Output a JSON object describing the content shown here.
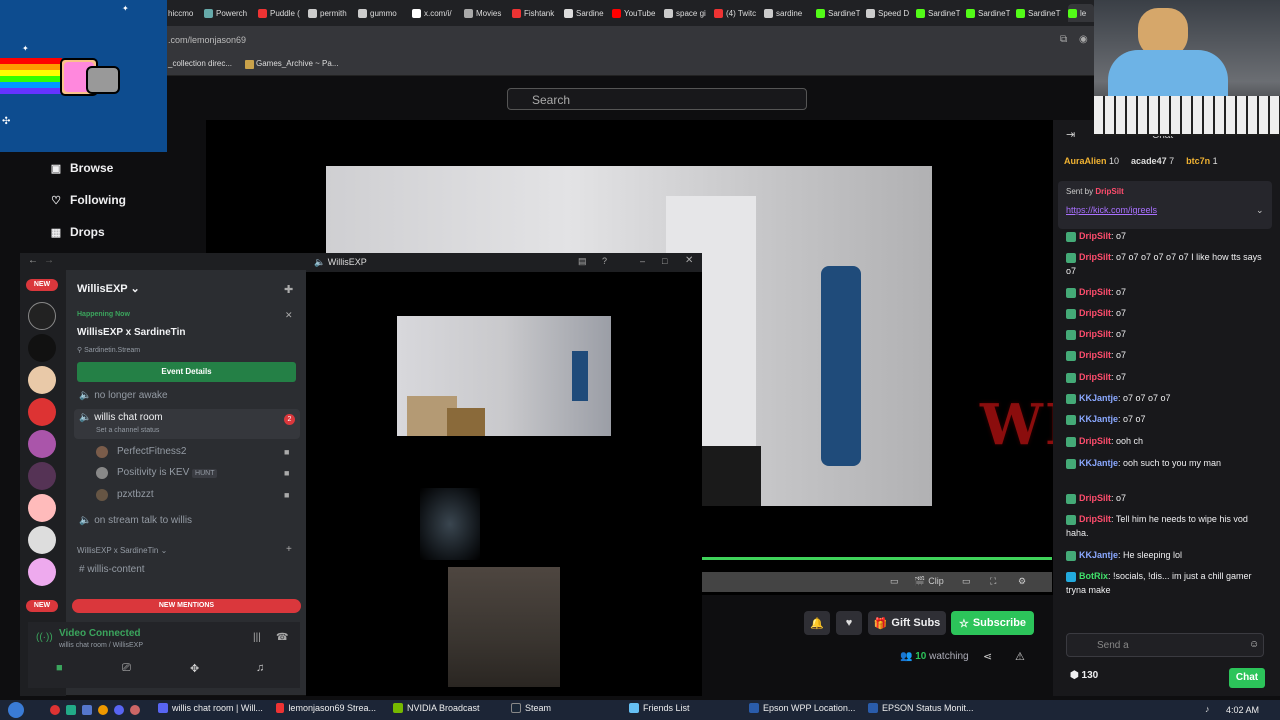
{
  "browser": {
    "tabs": [
      "hiccmo",
      "Powerch",
      "Puddle (",
      "permith",
      "gummo",
      "x.com/i/",
      "Movies ",
      "Fishtank",
      "Sardine",
      "YouTube",
      "space gi",
      "(4) Twitc",
      "sardine",
      "SardineT",
      "Speed D",
      "SardineT",
      "SardineT",
      "SardineT",
      "le"
    ],
    "address": ".com/lemonjason69",
    "bookmarks": [
      "_collection direc...",
      "Games_Archive ~ Pa..."
    ]
  },
  "twitch": {
    "search_placeholder": "Search",
    "nav": [
      {
        "label": "Browse",
        "icon": "browse-icon"
      },
      {
        "label": "Following",
        "icon": "heart-icon"
      },
      {
        "label": "Drops",
        "icon": "drops-icon"
      }
    ],
    "gift_subs": "Gift Subs",
    "subscribe": "Subscribe",
    "watching_count": "10",
    "watching_label": " watching",
    "clip": "Clip",
    "overlay_text": "WILLIS"
  },
  "chat": {
    "header": "Chat",
    "top_gifters": [
      {
        "name": "AuraAlien",
        "count": "10"
      },
      {
        "name": "acade47",
        "count": "7"
      },
      {
        "name": "btc7n",
        "count": "1"
      }
    ],
    "pinned_sent_by": "Sent by",
    "pinned_user": "DripSilt",
    "pinned_link": "https://kick.com/igreels",
    "messages": [
      {
        "user": "DripSilt",
        "text": ": o7",
        "color": "red"
      },
      {
        "user": "DripSilt",
        "text": ": o7 o7 o7 o7 o7 o7 I like how tts says o7",
        "color": "red"
      },
      {
        "user": "DripSilt",
        "text": ": o7",
        "color": "red"
      },
      {
        "user": "DripSilt",
        "text": ": o7",
        "color": "red"
      },
      {
        "user": "DripSilt",
        "text": ": o7",
        "color": "red"
      },
      {
        "user": "DripSilt",
        "text": ": o7",
        "color": "red"
      },
      {
        "user": "DripSilt",
        "text": ": o7",
        "color": "red"
      },
      {
        "user": "KKJantje",
        "text": ": o7 o7 o7 o7",
        "color": "blue"
      },
      {
        "user": "KKJantje",
        "text": ": o7 o7",
        "color": "blue"
      },
      {
        "user": "DripSilt",
        "text": ": ooh ch",
        "color": "red"
      },
      {
        "user": "KKJantje",
        "text": ": ooh such to you my man",
        "color": "blue"
      },
      {
        "user": "DripSilt",
        "text": ": o7",
        "color": "red"
      },
      {
        "user": "DripSilt",
        "text": ": Tell him he needs to wipe his vod haha.",
        "color": "red"
      },
      {
        "user": "KKJantje",
        "text": ": He sleeping lol",
        "color": "blue"
      },
      {
        "user": "BotRix",
        "text": ": !socials, !dis... im just a chill gamer tryna make",
        "color": "green"
      }
    ],
    "input_placeholder": "Send a",
    "points": "130",
    "chat_button": "Chat"
  },
  "discord": {
    "server_name": "WillisEXP",
    "happening_now": "Happening Now",
    "event_title": "WillisEXP x SardineTin",
    "event_location": "Sardinetin.Stream",
    "event_button": "Event Details",
    "channels": [
      {
        "name": "no longer awake",
        "type": "voice"
      },
      {
        "name": "willis chat room",
        "type": "voice",
        "status": "Set a channel status",
        "badge": "2"
      }
    ],
    "members": [
      {
        "name": "PerfectFitness2"
      },
      {
        "name": "Positivity is KEV",
        "tag": "HUNT"
      },
      {
        "name": "pzxtbzzt"
      }
    ],
    "channel_stream_talk": "on stream talk to willis",
    "category": "WillisEXP x SardineTin",
    "text_channel": "willis-content",
    "new_mentions": "NEW MENTIONS",
    "video_connected": "Video Connected",
    "video_location": "willis chat room / WillisEXP",
    "call_window_title": "WillisEXP",
    "server_badges": [
      "NEW",
      "NEW"
    ]
  },
  "taskbar": {
    "items": [
      "willis chat room | Will...",
      "lemonjason69 Strea...",
      "NVIDIA Broadcast",
      "Steam",
      "Friends List",
      "Epson WPP Location...",
      "EPSON Status Monit..."
    ],
    "clock": "4:02 AM"
  },
  "colors": {
    "twitch_bg": "#0e0e10",
    "subscribe_green": "#2cc45a",
    "discord_bg": "#2b2d31",
    "event_green": "#248046",
    "mention_red": "#da373c"
  }
}
